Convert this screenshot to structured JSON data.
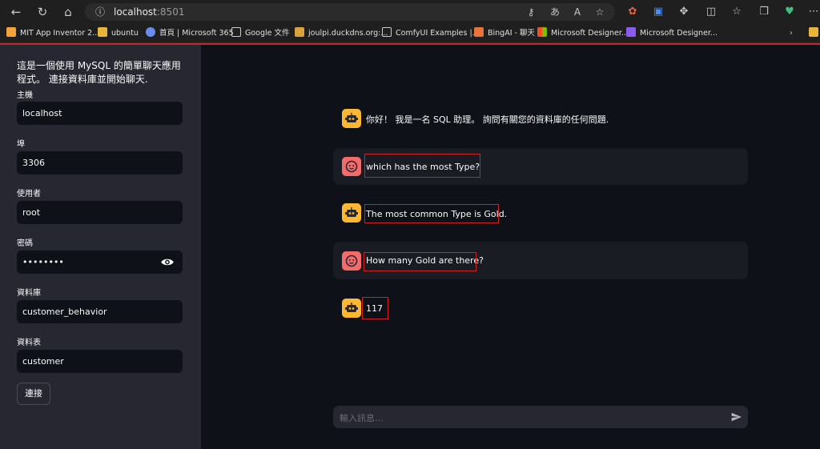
{
  "browser": {
    "url_host": "localhost",
    "url_port": ":8501",
    "bookmarks": [
      "MIT App Inventor 2...",
      "ubuntu",
      "首頁 | Microsoft 365",
      "Google 文件",
      "joulpi.duckdns.org:...",
      "ComfyUI Examples |...",
      "BingAI - 聊天",
      "Microsoft Designer...",
      "Microsoft Designer..."
    ],
    "accent_color": "#c2262e"
  },
  "sidebar": {
    "intro": "這是一個使用 MySQL 的簡單聊天應用程式。 連接資料庫並開始聊天.",
    "fields": [
      {
        "label": "主機",
        "value": "localhost"
      },
      {
        "label": "埠",
        "value": "3306"
      },
      {
        "label": "使用者",
        "value": "root"
      },
      {
        "label": "密碼",
        "value": "••••••••"
      },
      {
        "label": "資料庫",
        "value": "customer_behavior"
      },
      {
        "label": "資料表",
        "value": "customer"
      }
    ],
    "connect_label": "連接"
  },
  "chat": {
    "messages": [
      {
        "role": "assistant",
        "text": "你好！ 我是一名 SQL 助理。 詢問有關您的資料庫的任何問題."
      },
      {
        "role": "user",
        "text": "which has the most Type?"
      },
      {
        "role": "assistant",
        "text": "The most common Type is Gold."
      },
      {
        "role": "user",
        "text": "How many Gold are there?"
      },
      {
        "role": "assistant",
        "text": "117"
      }
    ],
    "input_placeholder": "輸入訊息..."
  }
}
